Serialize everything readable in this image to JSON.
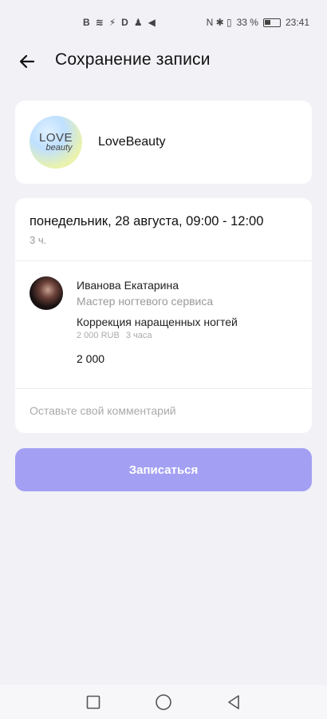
{
  "status_bar": {
    "left_icons": [
      "B",
      "≋",
      "⚡",
      "D",
      "♟",
      "◀"
    ],
    "right_text": "N ✱ ▯",
    "battery_percent": "33 %",
    "time": "23:41"
  },
  "header": {
    "title": "Сохранение записи"
  },
  "salon": {
    "logo_line1": "LOVE",
    "logo_line2": "beauty",
    "name": "LoveBeauty"
  },
  "booking": {
    "date_time": "понедельник, 28 августа, 09:00 - 12:00",
    "duration": "3 ч."
  },
  "master": {
    "name": "Иванова Екатарина",
    "role": "Мастер ногтевого сервиса"
  },
  "service": {
    "name": "Коррекция наращенных ногтей",
    "price": "2 000 RUB",
    "duration": "3 часа",
    "total": "2 000"
  },
  "comment": {
    "placeholder": "Оставьте свой комментарий",
    "value": ""
  },
  "actions": {
    "submit_label": "Записаться"
  },
  "colors": {
    "accent": "#a3a0f3",
    "background": "#f1f1f6"
  },
  "nav": {
    "icons": [
      "square-icon",
      "circle-icon",
      "triangle-back-icon"
    ]
  }
}
